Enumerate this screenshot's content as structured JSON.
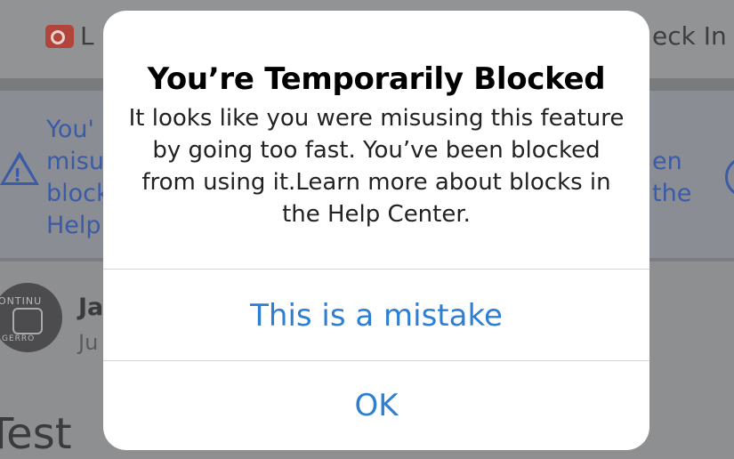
{
  "background": {
    "topbar": {
      "left_label": "L",
      "right_label": "eck In"
    },
    "notice": {
      "left_lines": [
        "You'",
        "misu",
        "block",
        "Help"
      ],
      "right_lines": [
        "en",
        "the"
      ]
    },
    "post": {
      "author_name": "Ja",
      "author_date": "Ju",
      "avatar_text_top": "ONTINU",
      "avatar_text_bottom": "GERRO",
      "text": "Test"
    }
  },
  "dialog": {
    "title": "You’re Temporarily Blocked",
    "message": "It looks like you were misusing this feature by going too fast. You’ve been blocked from using it.Learn more about blocks in the Help Center.",
    "buttons": {
      "mistake_label": "This is a mistake",
      "ok_label": "OK"
    }
  },
  "colors": {
    "dialog_button": "#2d7fd3",
    "link_blue_dimmed": "#3b5ba7",
    "live_icon": "#b2443c"
  }
}
